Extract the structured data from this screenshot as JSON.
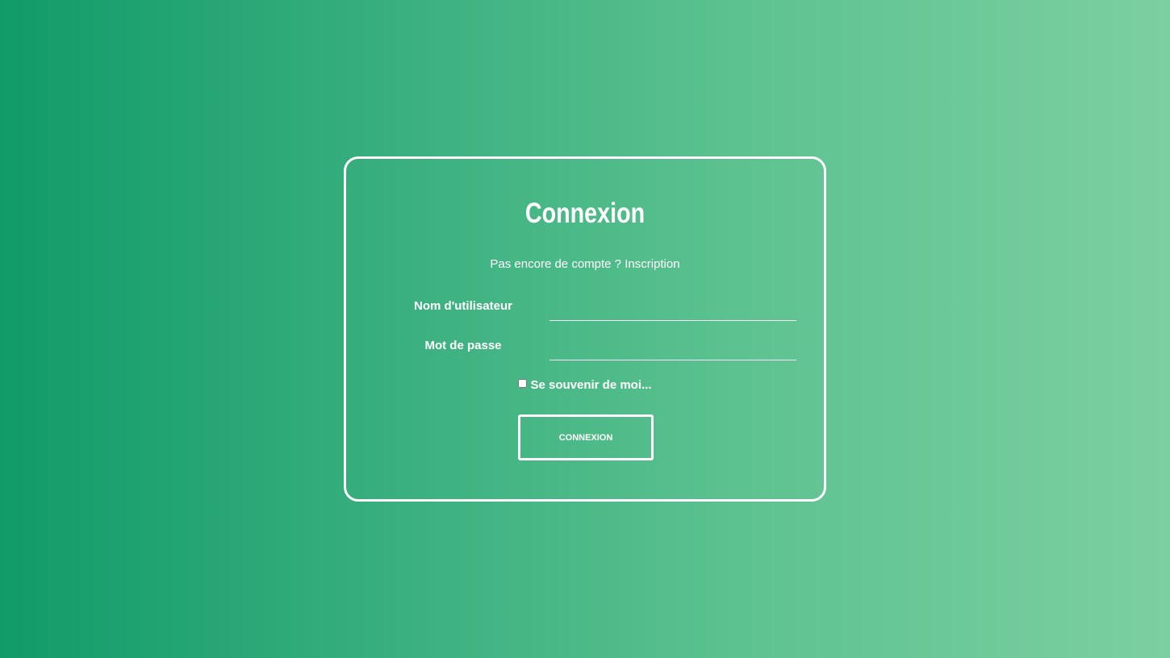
{
  "login": {
    "title": "Connexion",
    "no_account_text": "Pas encore de compte ?",
    "signup_link": "Inscription",
    "username_label": "Nom d'utilisateur",
    "username_value": "",
    "password_label": "Mot de passe",
    "password_value": "",
    "remember_label": "Se souvenir de moi...",
    "remember_checked": false,
    "submit_label": "CONNEXION"
  },
  "colors": {
    "gradient_start": "#119b69",
    "gradient_end": "#7ccfa1",
    "foreground": "#ffffff"
  }
}
